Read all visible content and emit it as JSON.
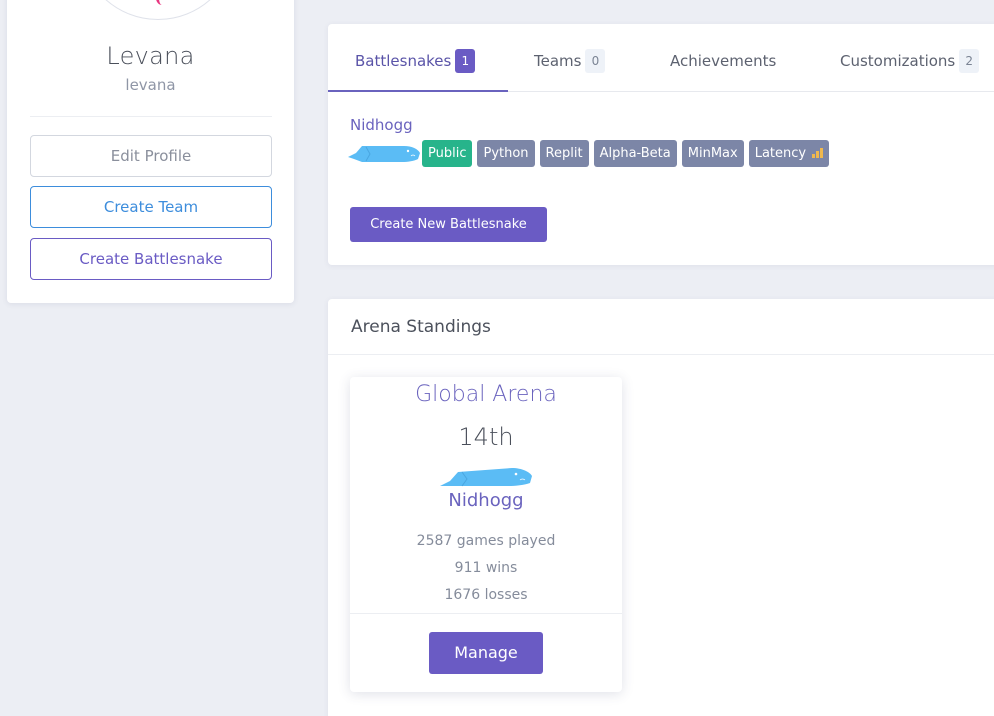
{
  "profile": {
    "name": "Levana",
    "handle": "levana",
    "buttons": {
      "edit": "Edit Profile",
      "create_team": "Create Team",
      "create_battlesnake": "Create Battlesnake"
    }
  },
  "tabs": [
    {
      "label": "Battlesnakes",
      "count": "1",
      "active": true
    },
    {
      "label": "Teams",
      "count": "0"
    },
    {
      "label": "Achievements"
    },
    {
      "label": "Customizations",
      "count": "2"
    }
  ],
  "battlesnake": {
    "name": "Nidhogg",
    "snake_icon": "snake-head-icon",
    "tags": [
      "Public",
      "Python",
      "Replit",
      "Alpha-Beta",
      "MinMax",
      "Latency"
    ],
    "latency_icon": "signal-bars-icon",
    "create_button": "Create New Battlesnake"
  },
  "arena": {
    "header": "Arena Standings",
    "card": {
      "title": "Global Arena",
      "rank": "14th",
      "snake_name": "Nidhogg",
      "games_played": "2587 games played",
      "wins": "911 wins",
      "losses": "1676 losses",
      "manage_button": "Manage"
    }
  },
  "colors": {
    "accent": "#6a5bc4",
    "blue": "#3d8ddc",
    "public_tag": "#27b48b",
    "tag": "#7c86a7",
    "snake": "#5bbcf5"
  }
}
